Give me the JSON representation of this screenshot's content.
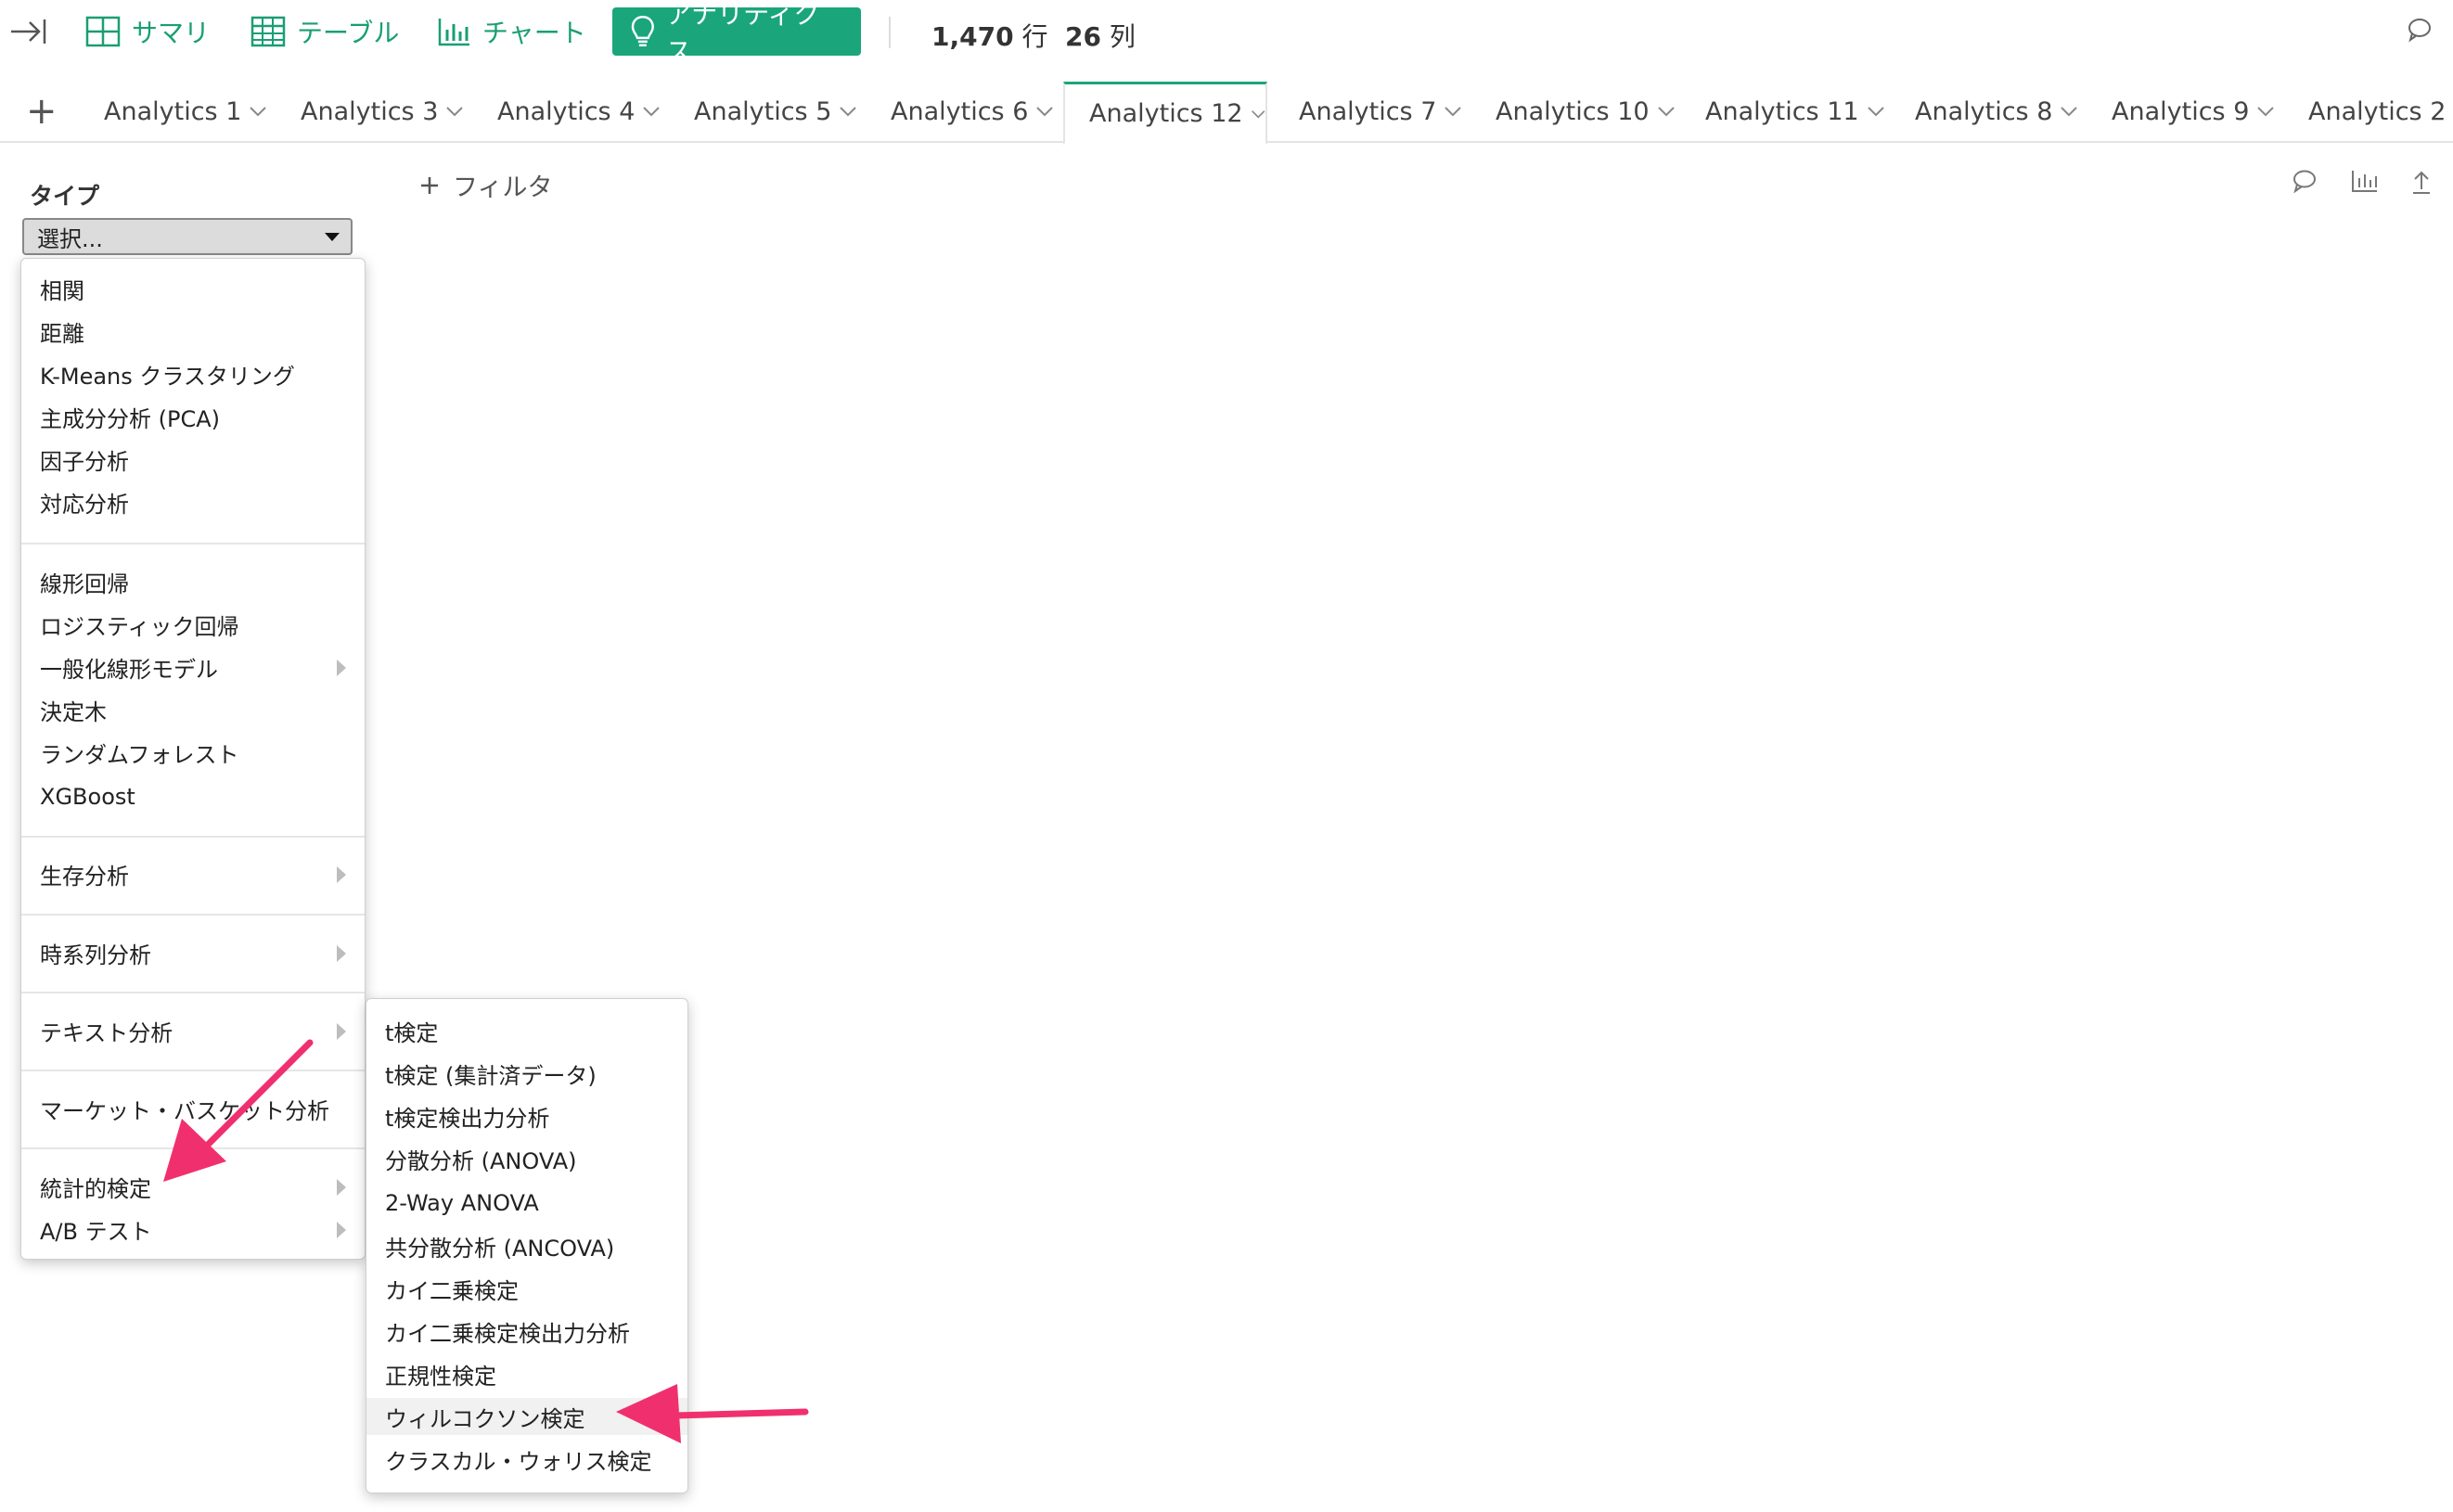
{
  "toolbar": {
    "collapse_icon": "collapse-right-icon",
    "summary": {
      "label": "サマリ",
      "icon": "grid-icon"
    },
    "table": {
      "label": "テーブル",
      "icon": "table-icon"
    },
    "chart": {
      "label": "チャート",
      "icon": "bar-chart-icon"
    },
    "analytics": {
      "label": "アナリティクス",
      "icon": "lightbulb-icon"
    },
    "rows": {
      "value": "1,470",
      "unit": "行"
    },
    "cols": {
      "value": "26",
      "unit": "列"
    },
    "comment_icon": "comment-icon"
  },
  "tabs": [
    {
      "label": "Analytics 1"
    },
    {
      "label": "Analytics 3"
    },
    {
      "label": "Analytics 4"
    },
    {
      "label": "Analytics 5"
    },
    {
      "label": "Analytics 6"
    },
    {
      "label": "Analytics 12",
      "active": true
    },
    {
      "label": "Analytics 7"
    },
    {
      "label": "Analytics 10"
    },
    {
      "label": "Analytics 11"
    },
    {
      "label": "Analytics 8"
    },
    {
      "label": "Analytics 9"
    },
    {
      "label": "Analytics 2"
    }
  ],
  "panel": {
    "type_label": "タイプ",
    "select_value": "選択...",
    "filter_label": "フィルタ"
  },
  "menu": {
    "group1": [
      "相関",
      "距離",
      "K-Means クラスタリング",
      "主成分分析 (PCA)",
      "因子分析",
      "対応分析"
    ],
    "group2": [
      "線形回帰",
      "ロジスティック回帰",
      "一般化線形モデル",
      "決定木",
      "ランダムフォレスト",
      "XGBoost"
    ],
    "survival": "生存分析",
    "timeseries": "時系列分析",
    "text": "テキスト分析",
    "basket": "マーケット・バスケット分析",
    "stat_test": "統計的検定",
    "ab_test": "A/B テスト"
  },
  "submenu": {
    "items": [
      "t検定",
      "t検定 (集計済データ)",
      "t検定検出力分析",
      "分散分析 (ANOVA)",
      "2-Way ANOVA",
      "共分散分析 (ANCOVA)",
      "カイ二乗検定",
      "カイ二乗検定検出力分析",
      "正規性検定",
      "ウィルコクソン検定",
      "クラスカル・ウォリス検定"
    ],
    "highlighted": "ウィルコクソン検定"
  },
  "colors": {
    "accent": "#1aa67a",
    "annotation": "#f0306e"
  }
}
